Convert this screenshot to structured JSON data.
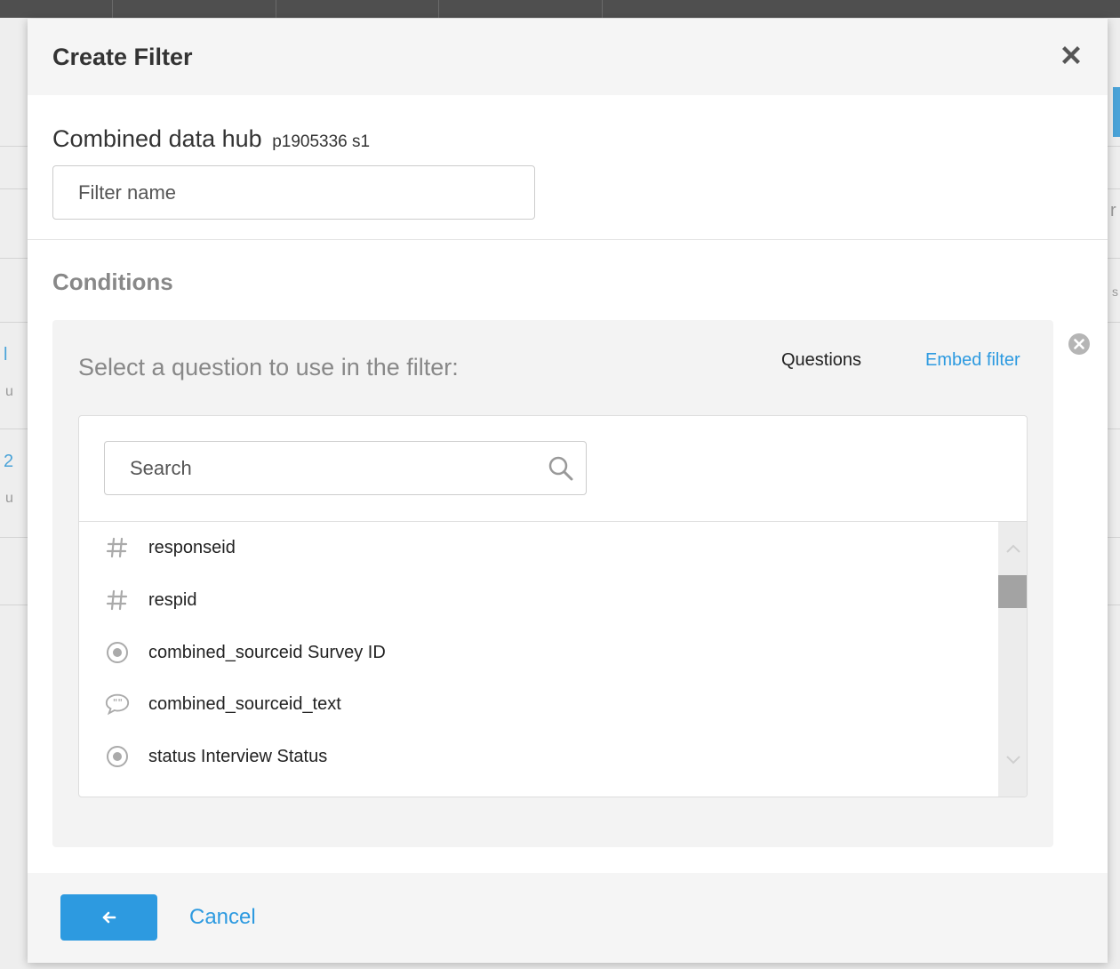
{
  "background": {
    "side_fragments": [
      "r",
      "s",
      "l",
      "u",
      "2",
      "u"
    ]
  },
  "modal": {
    "title": "Create Filter",
    "close_icon": "close-x-icon"
  },
  "filter": {
    "hub_name": "Combined data hub",
    "hub_code": "p1905336 s1",
    "name_placeholder": "Filter name",
    "name_value": ""
  },
  "conditions": {
    "title": "Conditions",
    "prompt": "Select a question to use in the filter:",
    "tabs": {
      "questions": "Questions",
      "embed": "Embed filter"
    },
    "search_placeholder": "Search",
    "search_value": "",
    "questions": [
      {
        "label": "responseid",
        "icon": "number-hash-icon"
      },
      {
        "label": "respid",
        "icon": "number-hash-icon"
      },
      {
        "label": "combined_sourceid Survey ID",
        "icon": "radio-single-choice-icon"
      },
      {
        "label": "combined_sourceid_text",
        "icon": "speech-bubble-text-icon"
      },
      {
        "label": "status Interview Status",
        "icon": "radio-single-choice-icon"
      }
    ]
  },
  "footer": {
    "back_icon": "arrow-left-icon",
    "cancel_label": "Cancel"
  },
  "colors": {
    "accent": "#2d9ae0",
    "header_bg": "#f5f5f5",
    "condition_bg": "#f3f3f3"
  }
}
